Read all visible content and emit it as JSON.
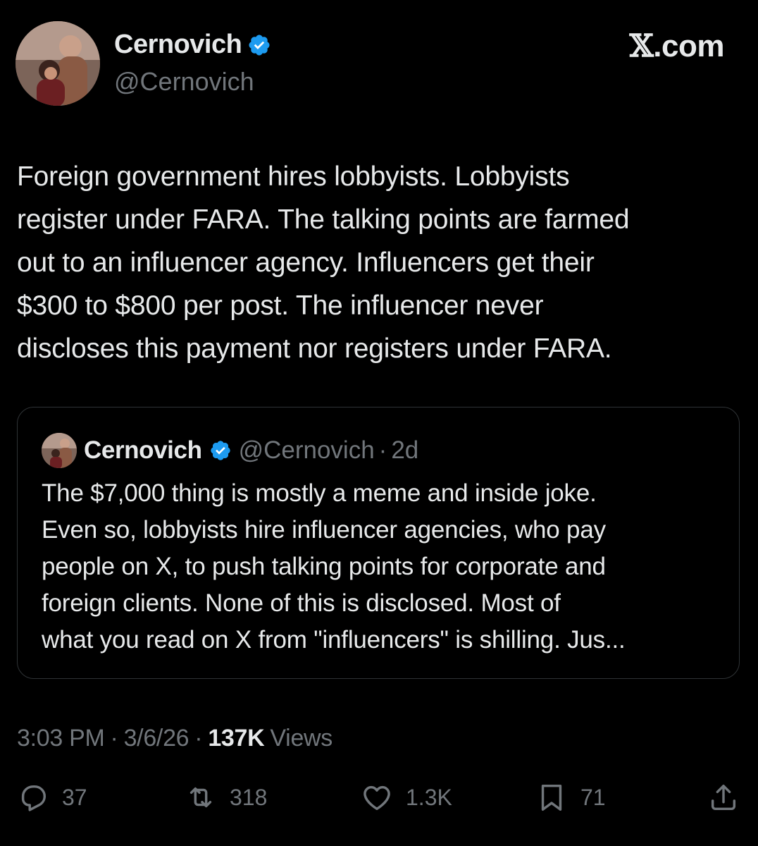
{
  "author": {
    "display_name": "Cernovich",
    "handle": "@Cernovich",
    "verified_color": "#1d9bf0"
  },
  "brand": {
    "x_mark": "𝕏",
    "suffix": ".com"
  },
  "tweet": {
    "text": "Foreign government hires lobbyists. Lobbyists\nregister under FARA. The talking points are farmed\nout to an influencer agency. Influencers get their\n$300 to $800  per post. The influencer never\ndiscloses this payment nor registers under FARA."
  },
  "quote": {
    "display_name": "Cernovich",
    "handle": "@Cernovich",
    "separator": "·",
    "time": "2d",
    "text": "The $7,000 thing is mostly a meme and inside joke.\nEven so, lobbyists hire influencer agencies, who pay\npeople on X, to push talking points for corporate and\nforeign clients. None of this is disclosed. Most of\nwhat you read on X from \"influencers\" is shilling. Jus..."
  },
  "meta": {
    "time": "3:03 PM",
    "sep1": "·",
    "date": "3/6/26",
    "sep2": "·",
    "views_count": "137K",
    "views_label": "Views"
  },
  "actions": {
    "reply_count": "37",
    "repost_count": "318",
    "like_count": "1.3K",
    "bookmark_count": "71"
  },
  "icons": {
    "reply": "reply-icon",
    "repost": "repost-icon",
    "like": "heart-icon",
    "bookmark": "bookmark-icon",
    "share": "share-icon",
    "verified": "verified-badge-icon"
  },
  "colors": {
    "background": "#000000",
    "text": "#e7e9ea",
    "muted": "#71767b",
    "border": "#2f3336",
    "verified": "#1d9bf0"
  }
}
